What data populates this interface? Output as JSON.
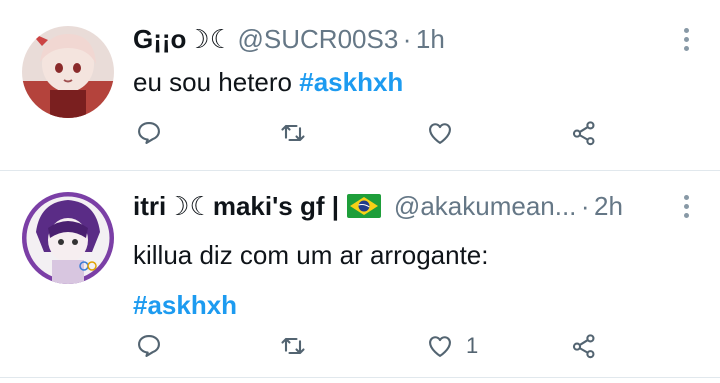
{
  "tweets": [
    {
      "display_name": "G¡¡o☽☾",
      "handle": "@SUCR00S3",
      "separator": "·",
      "time": "1h",
      "text": "eu sou hetero ",
      "hashtag": "#askhxh",
      "like_count": "",
      "avatar_icon": "avatar-anime-girl-red"
    },
    {
      "display_name": "itri☽☾maki's gf |",
      "flag_icon": "brazil-flag-icon",
      "handle": "@akakumean...",
      "separator": "·",
      "time": "2h",
      "text": "killua diz com um ar arrogante:",
      "hashtag": "#askhxh",
      "like_count": "1",
      "avatar_icon": "avatar-anime-purple"
    }
  ],
  "icons": {
    "reply": "reply-icon",
    "retweet": "retweet-icon",
    "like": "heart-icon",
    "share": "share-icon",
    "more": "more-vertical-icon"
  },
  "colors": {
    "hashtag": "#1d9bf0",
    "secondary_text": "#657786",
    "icon": "#536471",
    "divider": "#e1e8ed"
  }
}
